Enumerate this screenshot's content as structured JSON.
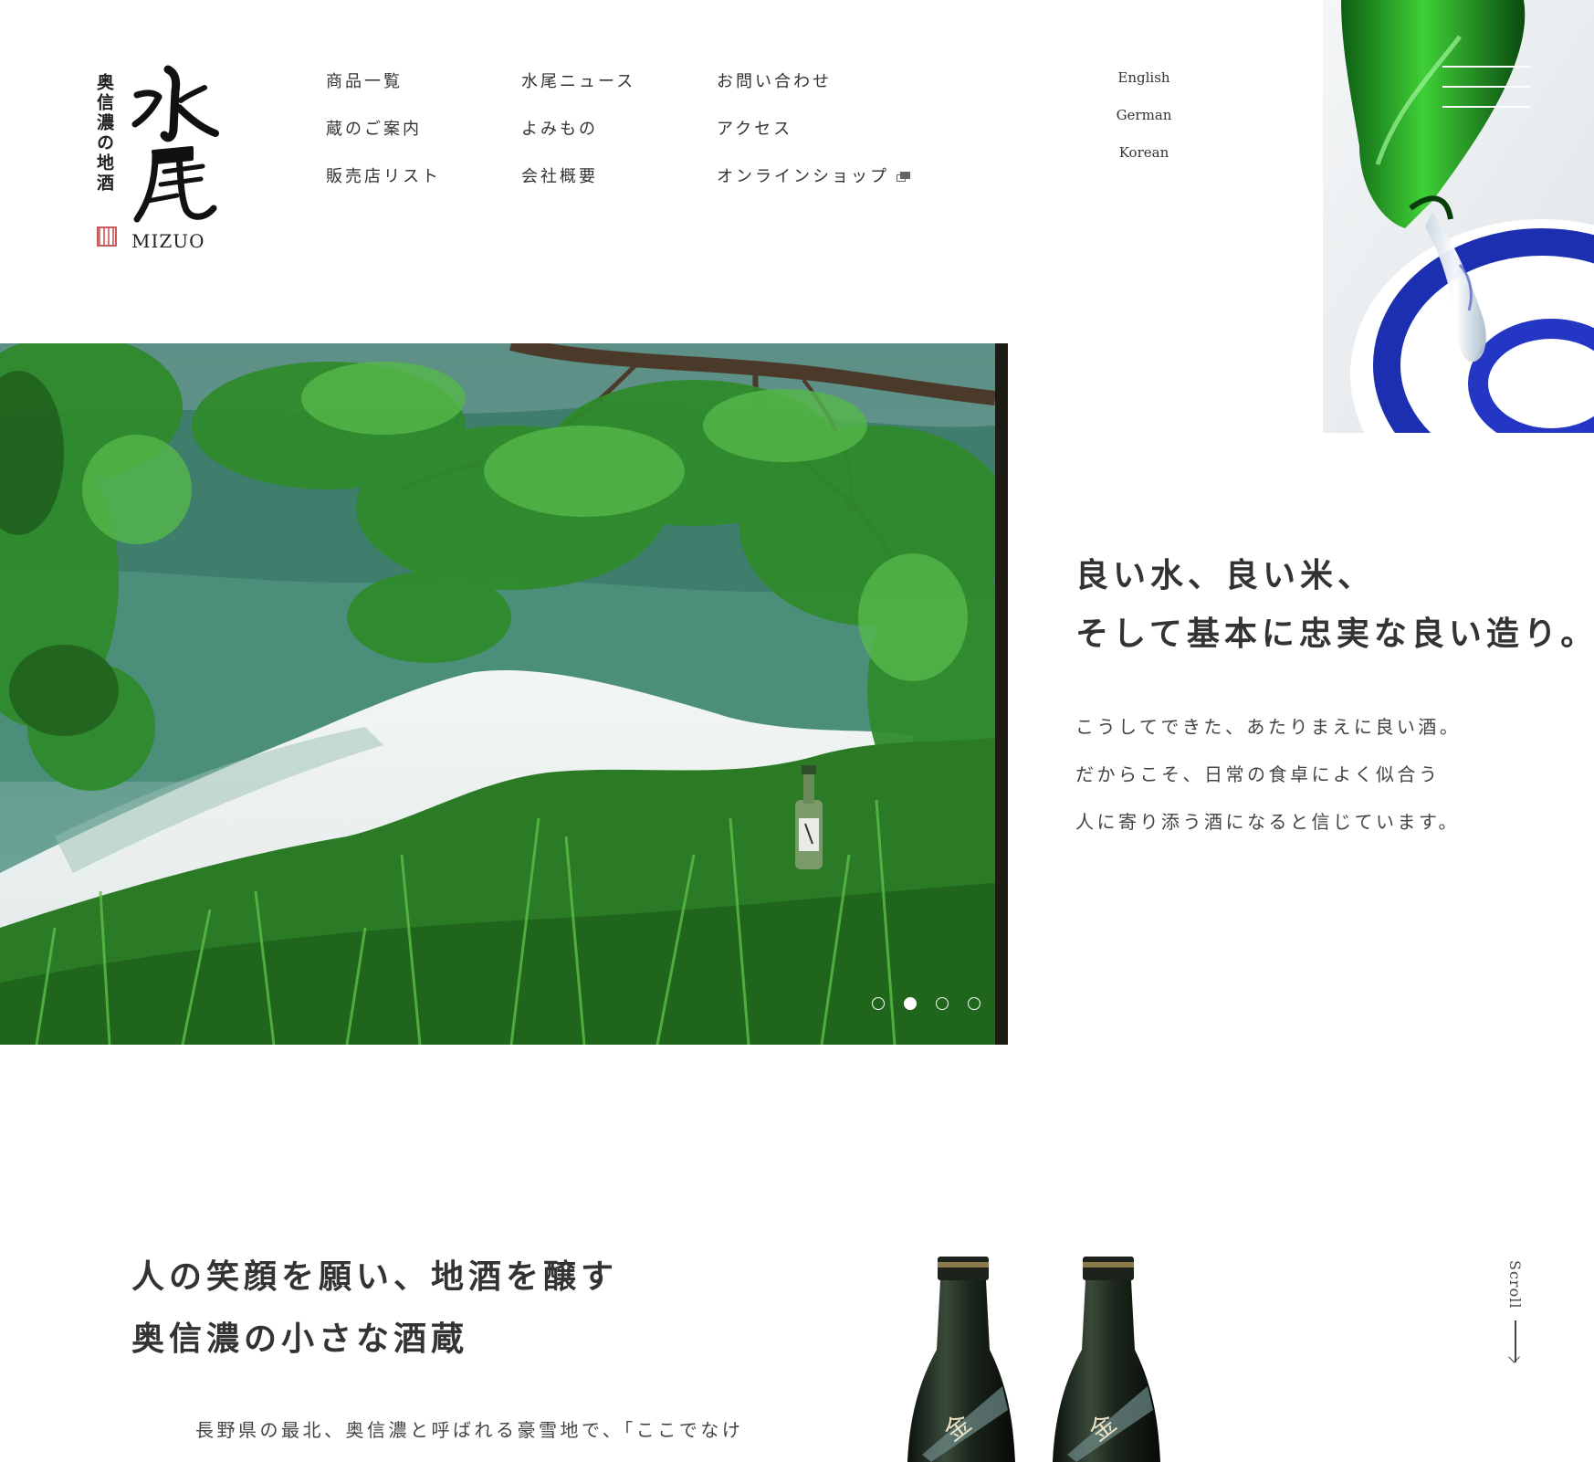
{
  "brand": {
    "tagline": "奥信濃の地酒",
    "logo_kanji": "水尾",
    "wordmark": "MIZUO"
  },
  "nav": {
    "col1": [
      "商品一覧",
      "蔵のご案内",
      "販売店リスト"
    ],
    "col2": [
      "水尾ニュース",
      "よみもの",
      "会社概要"
    ],
    "col3": [
      "お問い合わせ",
      "アクセス",
      "オンラインショップ"
    ]
  },
  "languages": [
    "English",
    "German",
    "Korean"
  ],
  "hero": {
    "slide_count": 4,
    "active_slide": 2
  },
  "intro": {
    "headline_1": "良い水、良い米、",
    "headline_2": "そして基本に忠実な良い造り。",
    "body_1": "こうしてできた、あたりまえに良い酒。",
    "body_2": "だからこそ、日常の食卓によく似合う",
    "body_3": "人に寄り添う酒になると信じています。"
  },
  "about": {
    "headline_1": "人の笑顔を願い、地酒を醸す",
    "headline_2": "奥信濃の小さな酒蔵",
    "body_1": "長野県の最北、奥信濃と呼ばれる豪雪地で、「ここでなけ"
  },
  "scroll_label": "Scroll",
  "colors": {
    "text": "#333333",
    "background": "#ffffff",
    "forest_green": "#2f8a2c",
    "lake_teal": "#5f9e8e"
  },
  "icons": [
    "external-link-icon",
    "hamburger-menu-icon",
    "arrow-down-icon"
  ]
}
